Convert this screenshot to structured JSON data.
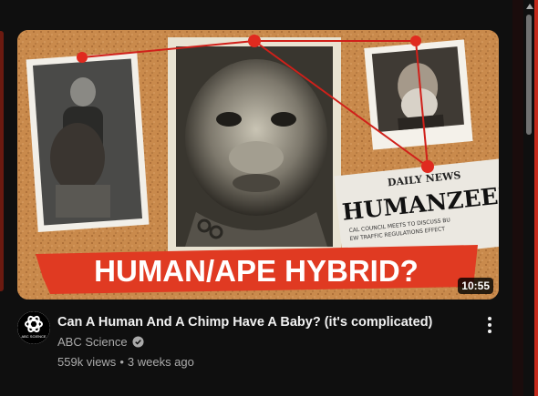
{
  "video": {
    "thumbnail": {
      "overlay_text": "HUMAN/APE HYBRID?",
      "newspaper_masthead": "DAILY NEWS",
      "newspaper_headline": "HUMANZEE?",
      "newspaper_line1": "CAL COUNCIL MEETS TO DISCUSS BU",
      "newspaper_line2": "EW TRAFFIC REGULATIONS EFFECT",
      "colors": {
        "cork": "#c98a4c",
        "banner_red": "#e03a22",
        "string_red": "#d0201a"
      }
    },
    "duration": "10:55",
    "title": "Can A Human And A Chimp Have A Baby? (it's complicated)",
    "channel": {
      "name": "ABC Science",
      "avatar_text": "ABC SCIENCE",
      "verified_icon": "verified-check-icon"
    },
    "views": "559k views",
    "separator": "•",
    "age": "3 weeks ago",
    "menu_icon": "more-vertical-icon"
  }
}
